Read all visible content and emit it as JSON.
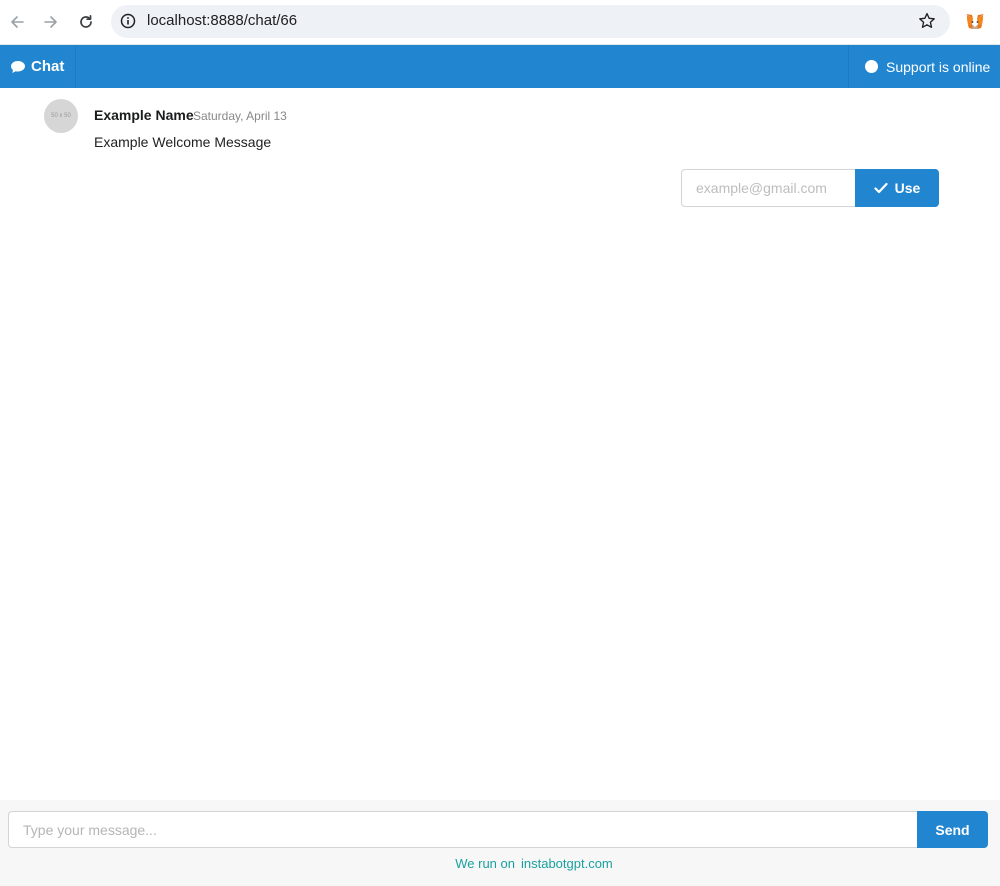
{
  "browser": {
    "url": "localhost:8888/chat/66",
    "icons": [
      "back-arrow-icon",
      "forward-arrow-icon",
      "reload-icon",
      "info-icon",
      "star-icon",
      "metamask-fox-icon"
    ]
  },
  "header": {
    "chat_label": "Chat",
    "chat_icon": "speech-bubble-icon",
    "status_label": "Support is online",
    "brand_color": "#2185d0"
  },
  "message": {
    "avatar_text": "50 x 50",
    "author": "Example Name",
    "date": "Saturday, April 13",
    "text": "Example Welcome Message"
  },
  "email_form": {
    "placeholder": "example@gmail.com",
    "value": "",
    "button_label": "Use",
    "button_icon": "checkmark-icon"
  },
  "composer": {
    "placeholder": "Type your message...",
    "send_label": "Send"
  },
  "footer": {
    "prefix": "We run on",
    "link_text": "instabotgpt.com",
    "link_color": "#1a9f9f"
  }
}
